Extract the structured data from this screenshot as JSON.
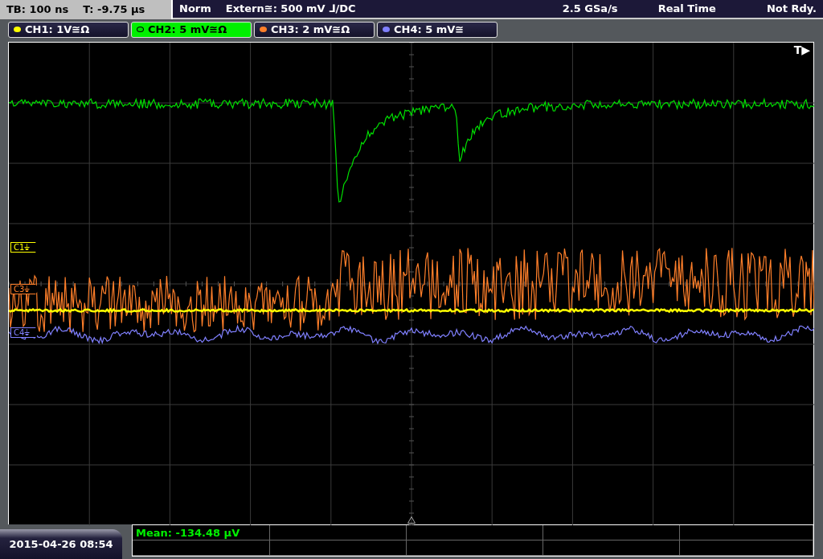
{
  "status_bar": {
    "timebase": "TB: 100 ns",
    "trigger_time": "T: -9.75 µs",
    "mode": "Norm",
    "trigger_source": "Extern≅: 500 mV ⅃/DC",
    "sample_rate": "2.5 GSa/s",
    "acquisition": "Real Time",
    "state": "Not Rdy."
  },
  "channels": [
    {
      "label": "CH1: 1V≅Ω",
      "marker": "C1⏚",
      "color": "#ffff00",
      "selected": false
    },
    {
      "label": "CH2: 5 mV≅Ω",
      "color": "#00e000",
      "selected": true
    },
    {
      "label": "CH3: 2 mV≅Ω",
      "marker": "C3⏚",
      "color": "#ff7f2a",
      "selected": false
    },
    {
      "label": "CH4: 5 mV≅",
      "marker": "C4⏚",
      "color": "#8080ff",
      "selected": false
    }
  ],
  "trigger_marker": "T▶",
  "measurements": {
    "cells": [
      "Mean: -134.48 µV"
    ]
  },
  "timestamp": "2015-04-26 08:54"
}
